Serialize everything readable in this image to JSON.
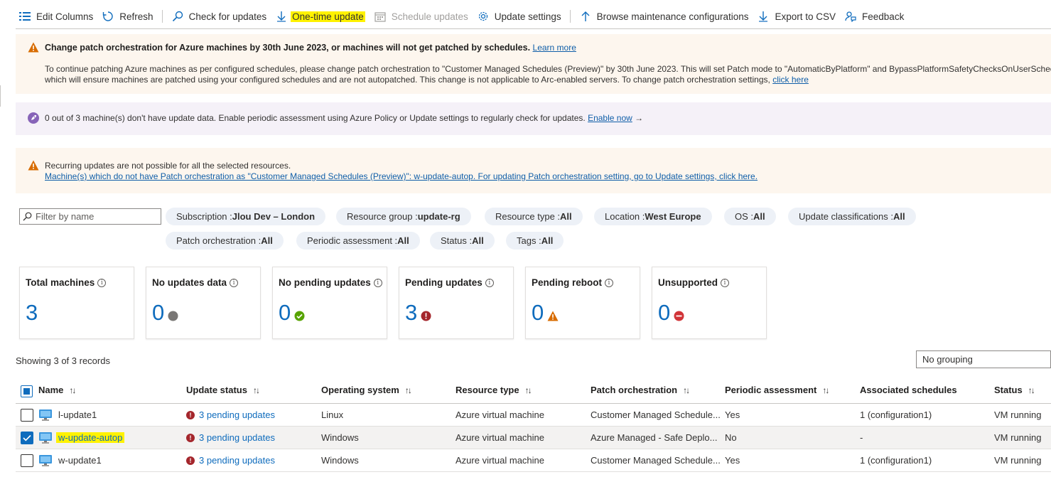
{
  "toolbar": {
    "edit_columns": "Edit Columns",
    "refresh": "Refresh",
    "check_updates": "Check for updates",
    "one_time_update": "One-time update",
    "schedule_updates": "Schedule updates",
    "update_settings": "Update settings",
    "browse_maintenance": "Browse maintenance configurations",
    "export_csv": "Export to CSV",
    "feedback": "Feedback"
  },
  "banner1": {
    "title": "Change patch orchestration for Azure machines by 30th June 2023, or machines will not get patched by schedules.",
    "title_link": "Learn more",
    "line1": "To continue patching Azure machines as per configured schedules, please change patch orchestration to \"Customer Managed Schedules (Preview)\" by 30th June 2023. This will set Patch mode to \"AutomaticByPlatform\" and BypassPlatformSafetyChecksOnUserSchedule",
    "line2": "which will ensure machines are patched using your configured schedules and are not autopatched. This change is not applicable to Arc-enabled servers. To change patch orchestration settings,",
    "line2_link": "click here"
  },
  "banner2": {
    "text": "0 out of 3 machine(s) don't have update data. Enable periodic assessment using Azure Policy or Update settings to regularly check for updates.",
    "link": "Enable now",
    "arrow": "→"
  },
  "banner3": {
    "line1": "Recurring updates are not possible for all the selected resources.",
    "line2": "Machine(s) which do not have Patch orchestration as \"Customer Managed Schedules (Preview)\": w-update-autop. For updating Patch orchestration setting, go to Update settings, click here."
  },
  "filter": {
    "placeholder": "Filter by name"
  },
  "pills": [
    {
      "key": "Subscription : ",
      "value": "Jlou Dev – London"
    },
    {
      "key": "Resource group : ",
      "value": "update-rg"
    },
    {
      "key": "Resource type : ",
      "value": "All"
    },
    {
      "key": "Location : ",
      "value": "West Europe"
    },
    {
      "key": "OS : ",
      "value": "All"
    },
    {
      "key": "Update classifications : ",
      "value": "All"
    },
    {
      "key": "Patch orchestration : ",
      "value": "All"
    },
    {
      "key": "Periodic assessment : ",
      "value": "All"
    },
    {
      "key": "Status : ",
      "value": "All"
    },
    {
      "key": "Tags : ",
      "value": "All"
    }
  ],
  "cards": [
    {
      "title": "Total machines",
      "value": "3",
      "status_icon": "none"
    },
    {
      "title": "No updates data",
      "value": "0",
      "status_icon": "grey-dot-icon"
    },
    {
      "title": "No pending updates",
      "value": "0",
      "status_icon": "green-check-icon"
    },
    {
      "title": "Pending updates",
      "value": "3",
      "status_icon": "red-error-icon"
    },
    {
      "title": "Pending reboot",
      "value": "0",
      "status_icon": "orange-warning-icon"
    },
    {
      "title": "Unsupported",
      "value": "0",
      "status_icon": "red-blocked-icon"
    }
  ],
  "records_text": "Showing 3 of 3 records",
  "grouping": "No grouping",
  "table": {
    "columns": [
      "Name",
      "Update status",
      "Operating system",
      "Resource type",
      "Patch orchestration",
      "Periodic assessment",
      "Associated schedules",
      "Status"
    ],
    "rows": [
      {
        "name": "l-update1",
        "update_status": "3 pending updates",
        "os": "Linux",
        "resource_type": "Azure virtual machine",
        "patch": "Customer Managed Schedule...",
        "periodic": "Yes",
        "schedules": "1 (configuration1)",
        "status": "VM running",
        "checked": false
      },
      {
        "name": "w-update-autop",
        "update_status": "3 pending updates",
        "os": "Windows",
        "resource_type": "Azure virtual machine",
        "patch": "Azure Managed - Safe Deplo...",
        "periodic": "No",
        "schedules": "-",
        "status": "VM running",
        "checked": true
      },
      {
        "name": "w-update1",
        "update_status": "3 pending updates",
        "os": "Windows",
        "resource_type": "Azure virtual machine",
        "patch": "Customer Managed Schedule...",
        "periodic": "Yes",
        "schedules": "1 (configuration1)",
        "status": "VM running",
        "checked": false
      }
    ]
  },
  "colors": {
    "accent": "#0f6cbd",
    "highlight": "#fff200",
    "warning": "#d86c00",
    "error": "#a4262c",
    "success": "#498205"
  }
}
